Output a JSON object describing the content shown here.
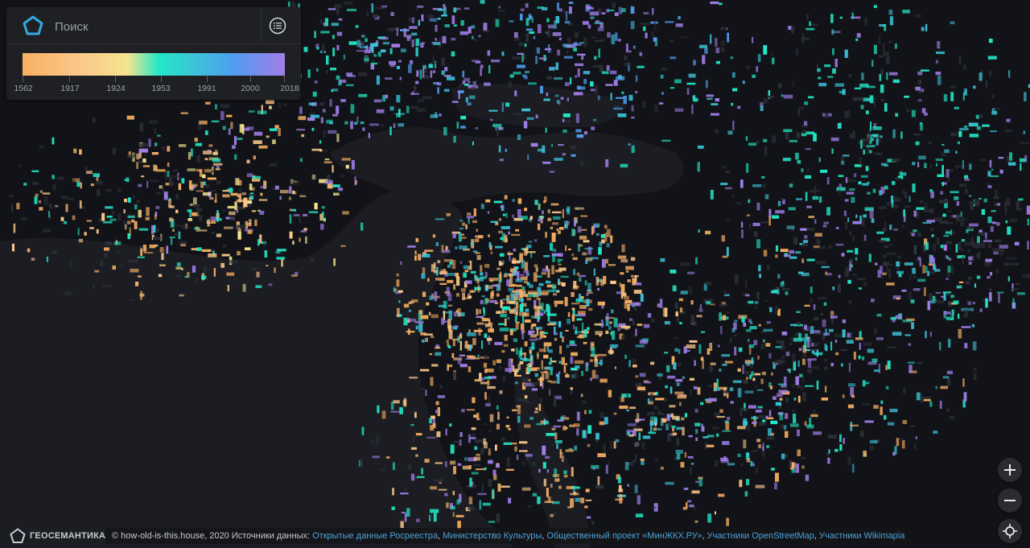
{
  "search": {
    "placeholder": "Поиск"
  },
  "legend": {
    "ticks": [
      "1562",
      "1917",
      "1924",
      "1953",
      "1991",
      "2000",
      "2018"
    ]
  },
  "colors": {
    "background": "#121318",
    "water": "#1b1d22",
    "accent": "#35a8e0",
    "buildings": [
      "#f8b063",
      "#fbc88a",
      "#f5e48e",
      "#23e8c7",
      "#3cc3d8",
      "#4f9ef0",
      "#a07ee8",
      "#2b2e35"
    ]
  },
  "controls": {
    "zoom_in_icon": "plus-icon",
    "zoom_out_icon": "minus-icon",
    "locate_icon": "crosshair-icon"
  },
  "brand": {
    "name": "ГЕОСЕМАНТИКА"
  },
  "attribution": {
    "prefix": "© how-old-is-this.house, 2020 Источники данных:",
    "links": [
      "Открытые данные Росреестра",
      "Министерство Культуры",
      "Общественный проект «МинЖКХ.РУ»",
      "Участники OpenStreetMap",
      "Участники Wikimapia"
    ]
  }
}
